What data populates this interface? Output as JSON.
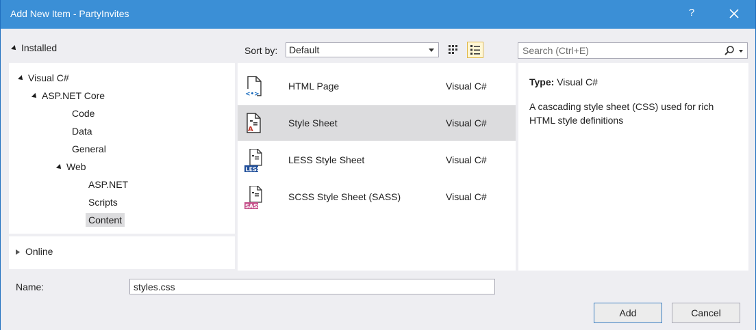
{
  "window": {
    "title": "Add New Item - PartyInvites",
    "help_label": "?"
  },
  "left_panel": {
    "installed_label": "Installed",
    "tree": [
      {
        "label": "Visual C#"
      },
      {
        "label": "ASP.NET Core"
      },
      {
        "label": "Code"
      },
      {
        "label": "Data"
      },
      {
        "label": "General"
      },
      {
        "label": "Web"
      },
      {
        "label": "ASP.NET"
      },
      {
        "label": "Scripts"
      },
      {
        "label": "Content",
        "selected": true
      }
    ],
    "online_label": "Online"
  },
  "toolbar": {
    "sort_label": "Sort by:",
    "sort_value": "Default",
    "search_placeholder": "Search (Ctrl+E)"
  },
  "templates": [
    {
      "name": "HTML Page",
      "language": "Visual C#",
      "icon": "html-page-icon"
    },
    {
      "name": "Style Sheet",
      "language": "Visual C#",
      "icon": "stylesheet-icon",
      "selected": true
    },
    {
      "name": "LESS Style Sheet",
      "language": "Visual C#",
      "icon": "less-icon",
      "badge": "LESS",
      "badge_color": "#1f4e9a"
    },
    {
      "name": "SCSS Style Sheet (SASS)",
      "language": "Visual C#",
      "icon": "sass-icon",
      "badge": "SASS",
      "badge_color": "#c6538c"
    }
  ],
  "details": {
    "type_label": "Type:",
    "type_value": "Visual C#",
    "description": "A cascading style sheet (CSS) used for rich HTML style definitions"
  },
  "name_field": {
    "label": "Name:",
    "value": "styles.css"
  },
  "buttons": {
    "add": "Add",
    "cancel": "Cancel"
  },
  "colors": {
    "titlebar": "#3b8fd6",
    "selection": "#dcdcde",
    "dialog_bg": "#eeeef2"
  }
}
